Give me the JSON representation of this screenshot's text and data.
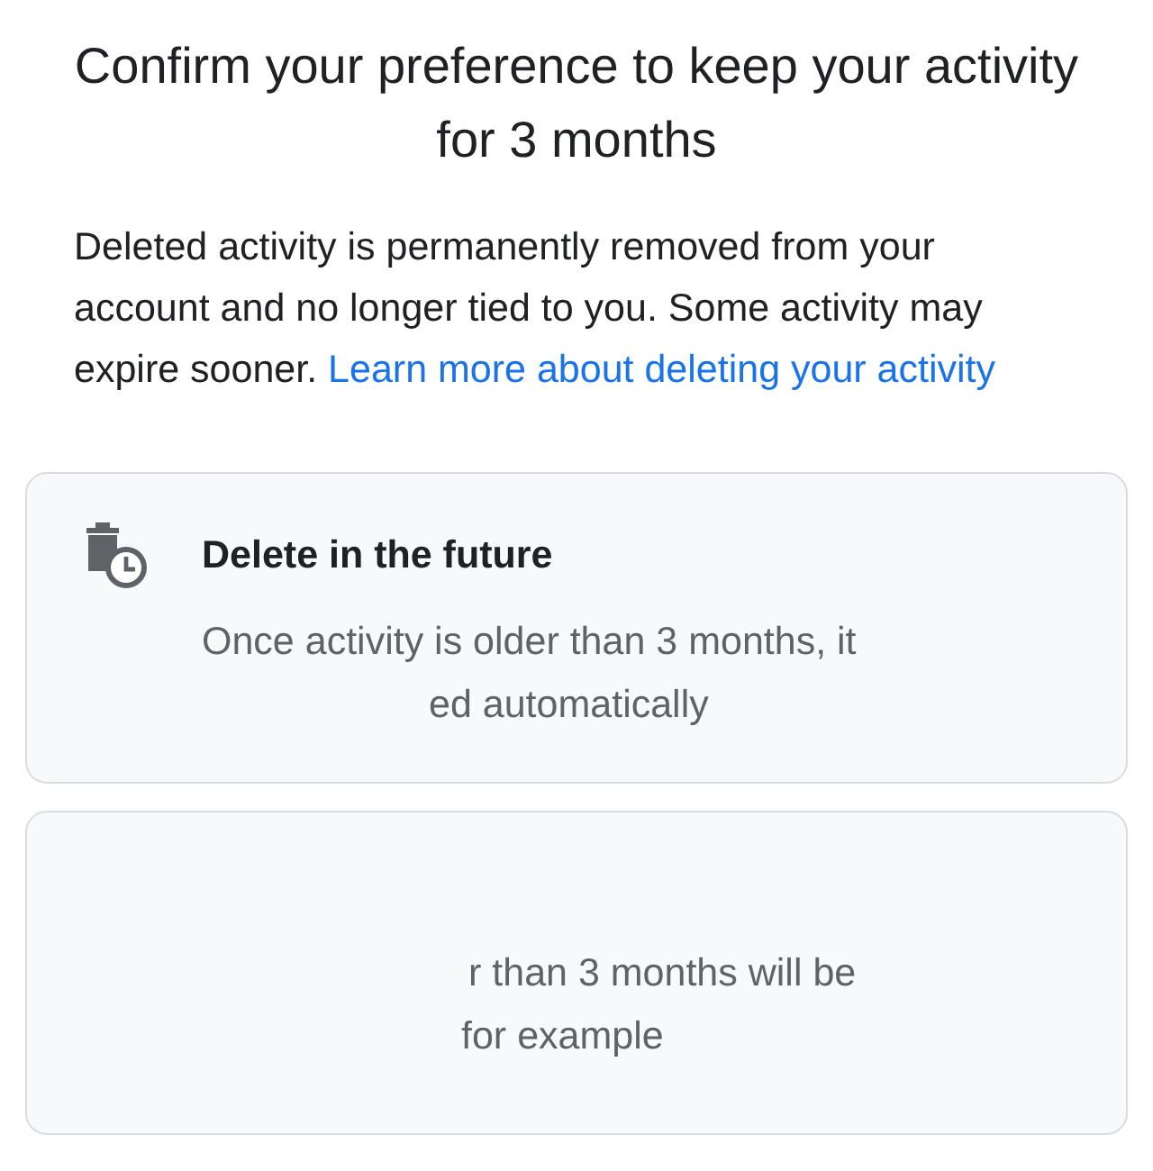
{
  "title": "Confirm your preference to keep your activity for 3 months",
  "intro": {
    "text": "Deleted activity is permanently removed from your account and no longer tied to you. Some activity may expire sooner.",
    "link": "Learn more about deleting your activity"
  },
  "options": [
    {
      "title": "Delete in the future",
      "lines": [
        "Once activity is older than 3 months, it",
        "ed automatically"
      ]
    },
    {
      "lines": [
        "r than 3 months will be",
        "for example"
      ]
    }
  ]
}
